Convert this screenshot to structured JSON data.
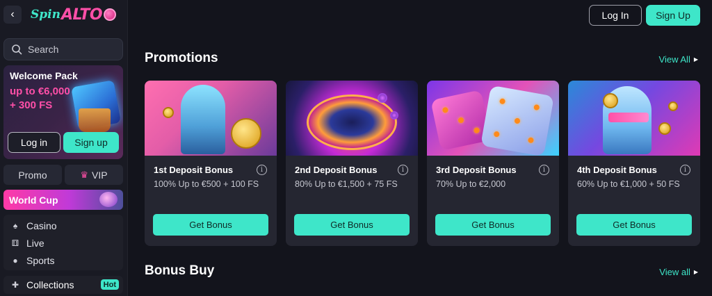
{
  "sidebar": {
    "logo_spin": "Spin",
    "logo_alto": "ALTO",
    "search_label": "Search",
    "welcome": {
      "title": "Welcome Pack",
      "amount_line1": "up to €6,000",
      "amount_line2": "+ 300 FS",
      "login": "Log in",
      "signup": "Sign up"
    },
    "promo": "Promo",
    "vip": "VIP",
    "world_cup": "World Cup",
    "nav": [
      "Casino",
      "Live",
      "Sports"
    ],
    "collections": "Collections",
    "hot_badge": "Hot"
  },
  "header": {
    "login": "Log In",
    "signup": "Sign Up"
  },
  "promotions": {
    "title": "Promotions",
    "view_all": "View All",
    "cards": [
      {
        "name": "1st Deposit Bonus",
        "desc": "100% Up to €500 + 100 FS",
        "button": "Get Bonus"
      },
      {
        "name": "2nd Deposit Bonus",
        "desc": "80% Up to €1,500 + 75 FS",
        "button": "Get Bonus"
      },
      {
        "name": "3rd Deposit Bonus",
        "desc": "70% Up to €2,000",
        "button": "Get Bonus"
      },
      {
        "name": "4th Deposit Bonus",
        "desc": "60% Up to €1,000 + 50 FS",
        "button": "Get Bonus"
      }
    ]
  },
  "bonus_buy": {
    "title": "Bonus Buy",
    "view_all": "View all"
  },
  "colors": {
    "accent": "#3ee6c9",
    "brand_pink": "#ff4fa8",
    "background": "#13141c"
  }
}
